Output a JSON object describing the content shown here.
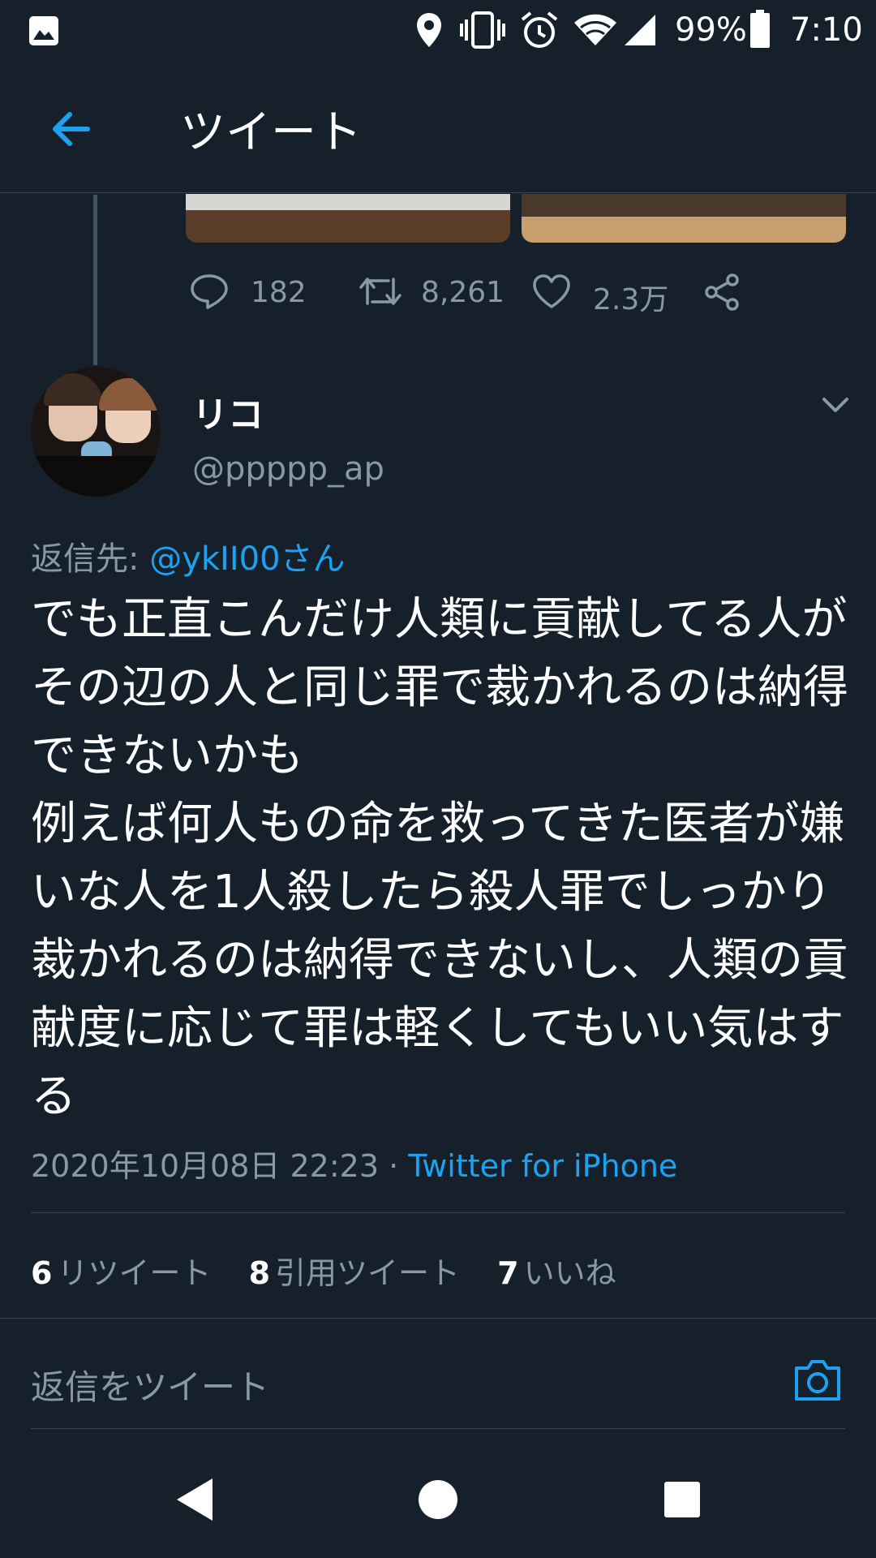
{
  "status_bar": {
    "battery": "99%",
    "time": "7:10",
    "icons": [
      "image-icon",
      "location-icon",
      "vibrate-icon",
      "alarm-icon",
      "wifi-icon",
      "signal-icon",
      "battery-icon"
    ]
  },
  "header": {
    "back_icon": "arrow-left-icon",
    "title": "ツイート"
  },
  "previous_tweet": {
    "replies": "182",
    "retweets": "8,261",
    "likes": "2.3万"
  },
  "tweet": {
    "author_name": "リコ",
    "author_handle": "@ppppp_ap",
    "reply_label": "返信先: ",
    "reply_mention": "@ykII00さん",
    "text": "でも正直こんだけ人類に貢献してる人がその辺の人と同じ罪で裁かれるのは納得できないかも\n例えば何人もの命を救ってきた医者が嫌いな人を1人殺したら殺人罪でしっかり裁かれるのは納得できないし、人類の貢献度に応じて罪は軽くしてもいい気はする",
    "timestamp": "2020年10月08日 22:23",
    "separator": " · ",
    "source": "Twitter for iPhone"
  },
  "stats": {
    "retweets_count": "6",
    "retweets_label": "リツイート",
    "quotes_count": "8",
    "quotes_label": "引用ツイート",
    "likes_count": "7",
    "likes_label": "いいね"
  },
  "reply_box": {
    "placeholder": "返信をツイート"
  },
  "colors": {
    "background": "#15202b",
    "accent": "#1da1f2",
    "secondary_text": "#8899a6",
    "divider": "#38444d"
  }
}
